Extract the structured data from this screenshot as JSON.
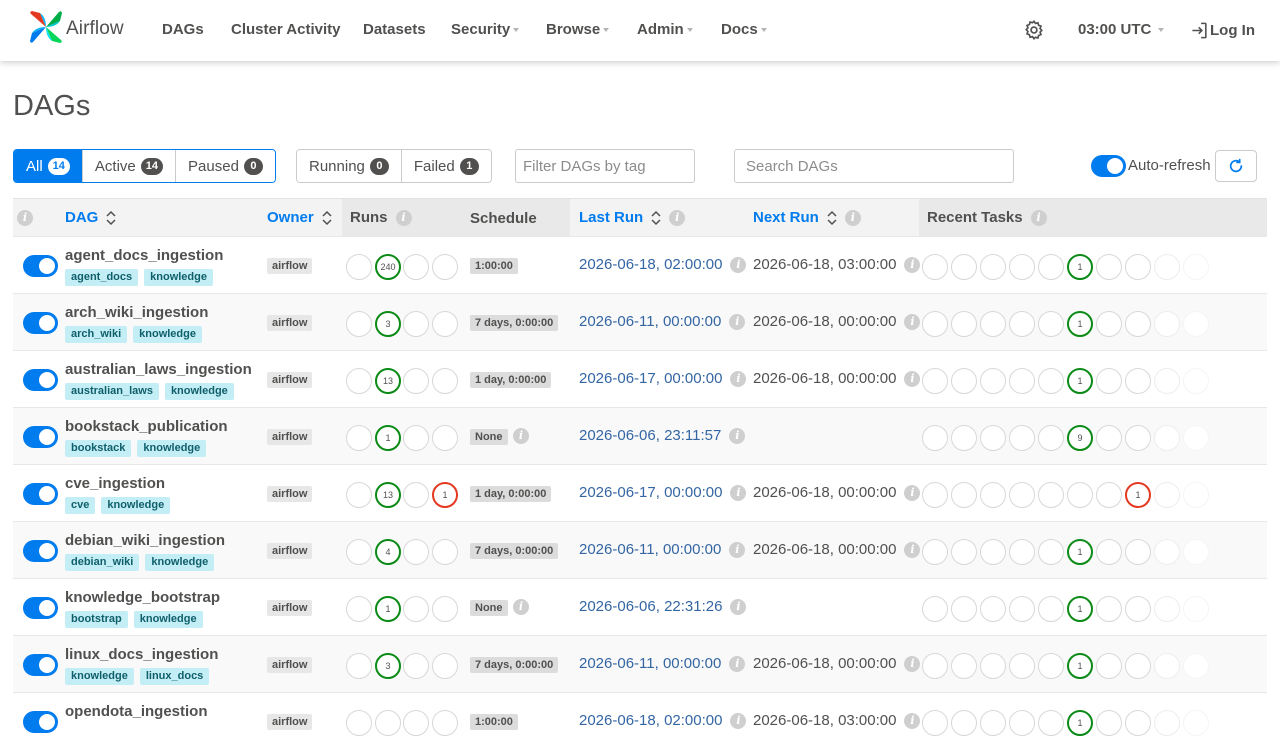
{
  "nav": {
    "brand": "Airflow",
    "items": [
      {
        "label": "DAGs",
        "dropdown": false
      },
      {
        "label": "Cluster Activity",
        "dropdown": false
      },
      {
        "label": "Datasets",
        "dropdown": false
      },
      {
        "label": "Security",
        "dropdown": true
      },
      {
        "label": "Browse",
        "dropdown": true
      },
      {
        "label": "Admin",
        "dropdown": true
      },
      {
        "label": "Docs",
        "dropdown": true
      }
    ],
    "timezone": "03:00 UTC",
    "login": "Log In",
    "icons": [
      "airflow-logo",
      "gear-icon",
      "login-icon"
    ]
  },
  "page": {
    "title": "DAGs"
  },
  "filters": {
    "status": [
      {
        "label": "All",
        "count": "14",
        "active": true
      },
      {
        "label": "Active",
        "count": "14",
        "active": false
      },
      {
        "label": "Paused",
        "count": "0",
        "active": false
      }
    ],
    "runs": [
      {
        "label": "Running",
        "count": "0"
      },
      {
        "label": "Failed",
        "count": "1"
      }
    ],
    "tag_placeholder": "Filter DAGs by tag",
    "search_placeholder": "Search DAGs",
    "autorefresh_label": "Auto-refresh",
    "autorefresh_on": true
  },
  "table": {
    "headers": {
      "dag": "DAG",
      "owner": "Owner",
      "runs": "Runs",
      "schedule": "Schedule",
      "last_run": "Last Run",
      "next_run": "Next Run",
      "recent_tasks": "Recent Tasks"
    },
    "rows": [
      {
        "dag_id": "agent_docs_ingestion",
        "tags": [
          "agent_docs",
          "knowledge"
        ],
        "owner": "airflow",
        "runs": [
          "",
          "240",
          "",
          ""
        ],
        "schedule": "1:00:00",
        "schedule_info": false,
        "last_run": "2026-06-18, 02:00:00",
        "next_run": "2026-06-18, 03:00:00",
        "tasks": [
          "",
          "",
          "",
          "",
          "",
          "1",
          "",
          "",
          "",
          ""
        ]
      },
      {
        "dag_id": "arch_wiki_ingestion",
        "tags": [
          "arch_wiki",
          "knowledge"
        ],
        "owner": "airflow",
        "runs": [
          "",
          "3",
          "",
          ""
        ],
        "schedule": "7 days, 0:00:00",
        "schedule_info": false,
        "last_run": "2026-06-11, 00:00:00",
        "next_run": "2026-06-18, 00:00:00",
        "tasks": [
          "",
          "",
          "",
          "",
          "",
          "1",
          "",
          "",
          "",
          ""
        ]
      },
      {
        "dag_id": "australian_laws_ingestion",
        "tags": [
          "australian_laws",
          "knowledge"
        ],
        "owner": "airflow",
        "runs": [
          "",
          "13",
          "",
          ""
        ],
        "schedule": "1 day, 0:00:00",
        "schedule_info": false,
        "last_run": "2026-06-17, 00:00:00",
        "next_run": "2026-06-18, 00:00:00",
        "tasks": [
          "",
          "",
          "",
          "",
          "",
          "1",
          "",
          "",
          "",
          ""
        ]
      },
      {
        "dag_id": "bookstack_publication",
        "tags": [
          "bookstack",
          "knowledge"
        ],
        "owner": "airflow",
        "runs": [
          "",
          "1",
          "",
          ""
        ],
        "schedule": "None",
        "schedule_info": true,
        "last_run": "2026-06-06, 23:11:57",
        "next_run": "",
        "tasks": [
          "",
          "",
          "",
          "",
          "",
          "9",
          "",
          "",
          "",
          ""
        ]
      },
      {
        "dag_id": "cve_ingestion",
        "tags": [
          "cve",
          "knowledge"
        ],
        "owner": "airflow",
        "runs": [
          "",
          "13",
          "",
          "1"
        ],
        "schedule": "1 day, 0:00:00",
        "schedule_info": false,
        "last_run": "2026-06-17, 00:00:00",
        "next_run": "2026-06-18, 00:00:00",
        "tasks": [
          "",
          "",
          "",
          "",
          "",
          "",
          "",
          "1",
          "",
          ""
        ]
      },
      {
        "dag_id": "debian_wiki_ingestion",
        "tags": [
          "debian_wiki",
          "knowledge"
        ],
        "owner": "airflow",
        "runs": [
          "",
          "4",
          "",
          ""
        ],
        "schedule": "7 days, 0:00:00",
        "schedule_info": false,
        "last_run": "2026-06-11, 00:00:00",
        "next_run": "2026-06-18, 00:00:00",
        "tasks": [
          "",
          "",
          "",
          "",
          "",
          "1",
          "",
          "",
          "",
          ""
        ]
      },
      {
        "dag_id": "knowledge_bootstrap",
        "tags": [
          "bootstrap",
          "knowledge"
        ],
        "owner": "airflow",
        "runs": [
          "",
          "1",
          "",
          ""
        ],
        "schedule": "None",
        "schedule_info": true,
        "last_run": "2026-06-06, 22:31:26",
        "next_run": "",
        "tasks": [
          "",
          "",
          "",
          "",
          "",
          "1",
          "",
          "",
          "",
          ""
        ]
      },
      {
        "dag_id": "linux_docs_ingestion",
        "tags": [
          "knowledge",
          "linux_docs"
        ],
        "owner": "airflow",
        "runs": [
          "",
          "3",
          "",
          ""
        ],
        "schedule": "7 days, 0:00:00",
        "schedule_info": false,
        "last_run": "2026-06-11, 00:00:00",
        "next_run": "2026-06-18, 00:00:00",
        "tasks": [
          "",
          "",
          "",
          "",
          "",
          "1",
          "",
          "",
          "",
          ""
        ]
      },
      {
        "dag_id": "opendota_ingestion",
        "tags": [],
        "owner": "airflow",
        "runs": [
          "",
          "",
          "",
          ""
        ],
        "schedule": "1:00:00",
        "schedule_info": false,
        "last_run": "2026-06-18, 02:00:00",
        "next_run": "2026-06-18, 03:00:00",
        "tasks": [
          "",
          "",
          "",
          "",
          "",
          "1",
          "",
          "",
          "",
          ""
        ]
      }
    ]
  },
  "colors": {
    "accent": "#017cee",
    "success": "#0b8a16",
    "failed": "#e43921",
    "tag_bg": "#c4eef5",
    "text": "#51504f",
    "link": "#3466a3"
  }
}
